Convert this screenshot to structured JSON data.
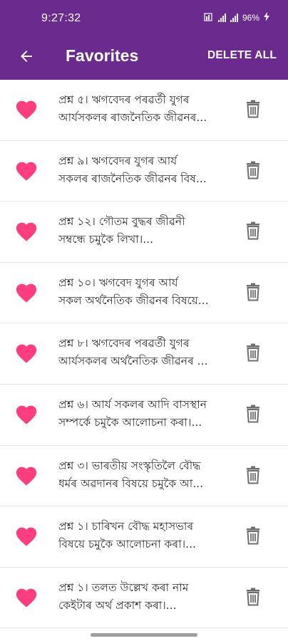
{
  "status_bar": {
    "time": "9:27:32",
    "battery": "96%",
    "icons": [
      "sim-icon",
      "signal-icon",
      "signal-icon",
      "battery-charging-icon"
    ]
  },
  "header": {
    "title": "Favorites",
    "back_icon": "arrow-left-icon",
    "delete_all_label": "DELETE ALL"
  },
  "colors": {
    "brand": "#6b2a8e",
    "heart": "#ff3d7f",
    "trash": "#6e6e6e"
  },
  "favorites": [
    {
      "line1": "প্ৰশ্ন ৫। ঋগবেদৰ পৰৱৰ্তী যুগৰ",
      "line2": "আৰ্যসকলৰ ৰাজনৈতিক জীৱনৰ..."
    },
    {
      "line1": "প্ৰশ্ন ৯। ঋগবেদৰ যুগৰ আৰ্য",
      "line2": "সকলৰ ৰাজনৈতিক জীৱনৰ বিষ..."
    },
    {
      "line1": "প্ৰশ্ন ১২। গৌতম বুদ্ধৰ জীৱনী",
      "line2": "সম্বন্ধে চমুকৈ লিখা।..."
    },
    {
      "line1": "প্ৰশ্ন ১০। ঋগবেদ যুগৰ আৰ্য",
      "line2": "সকল অৰ্থনৈতিক জীৱনৰ বিষয়ে..."
    },
    {
      "line1": "প্ৰশ্ন ৮। ঋগবেদৰ পৰৱৰ্তী যুগৰ",
      "line2": "আৰ্যসকলৰ অৰ্থনৈতিক জীৱনৰ ..."
    },
    {
      "line1": "প্ৰশ্ন ৬। আৰ্য সকলৰ আদি বাসস্থান",
      "line2": "সম্পৰ্কে চমুকৈ আলোচনা কৰা।..."
    },
    {
      "line1": "প্ৰশ্ন ৩। ভাৰতীয় সংস্কৃতিলৈ বৌদ্ধ",
      "line2": "ধৰ্মৰ অৱদানৰ বিষয়ে চমুকৈ আ..."
    },
    {
      "line1": "প্ৰশ্ন ১। চাৰিখন বৌদ্ধ মহাসভাৰ",
      "line2": "বিষয়ে চমুকৈ আলোচনা কৰা।..."
    },
    {
      "line1": "প্ৰশ্ন ১। তলত উল্লেখ কৰা নাম",
      "line2": "কেইটাৰ অৰ্থ প্ৰকাশ কৰা।..."
    }
  ]
}
